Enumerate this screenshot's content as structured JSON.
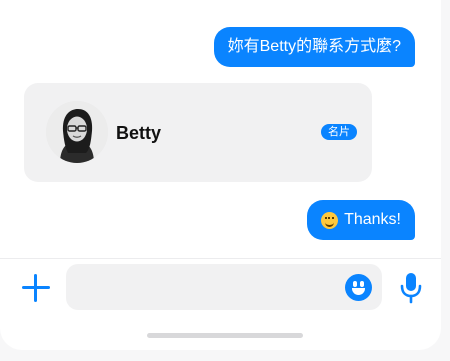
{
  "messages": {
    "outgoing_question": "妳有Betty的聯系方式麼?",
    "outgoing_thanks": "Thanks!"
  },
  "contact_card": {
    "name": "Betty",
    "badge": "名片"
  },
  "icons": {
    "attach": "plus-icon",
    "emoji": "emoji-icon",
    "voice": "microphone-icon",
    "inline_emoji": "grinning-face-icon"
  },
  "composer": {
    "placeholder": ""
  },
  "colors": {
    "accent": "#0a84ff",
    "card_bg": "#f1f1f2",
    "bubble_text": "#ffffff"
  }
}
